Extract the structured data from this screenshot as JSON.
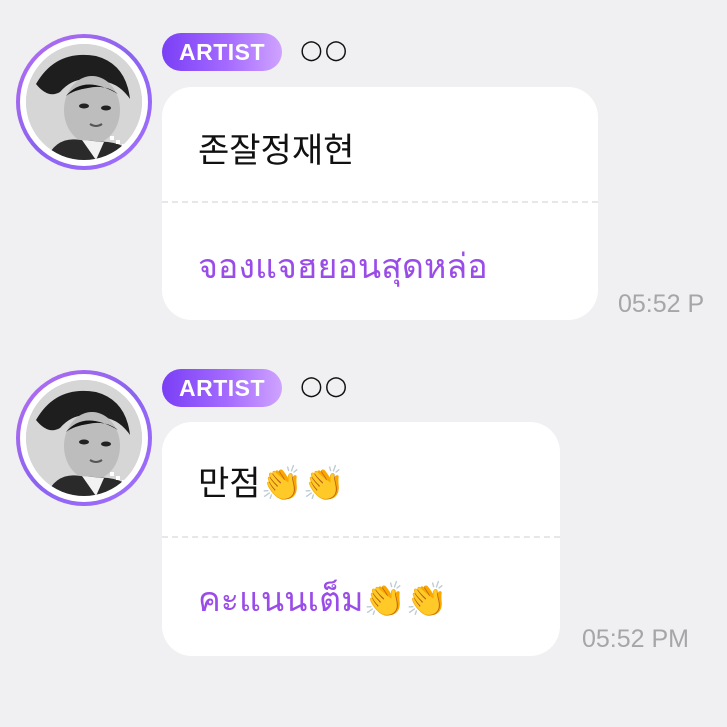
{
  "messages": [
    {
      "badge": "ARTIST",
      "sender": "○○",
      "text": "존잘정재현",
      "translation": "จองแจฮยอนสุดหล่อ",
      "time": "05:52 P"
    },
    {
      "badge": "ARTIST",
      "sender": "○○",
      "text": "만점👏👏",
      "translation": "คะแนนเต็ม👏👏",
      "time": "05:52 PM"
    }
  ],
  "colors": {
    "background": "#f0f0f2",
    "bubble": "#ffffff",
    "translation_text": "#9a4ce8",
    "badge_start": "#7a3ff5",
    "badge_end": "#cfa3ff",
    "time_text": "#a6a6aa"
  },
  "icons": {
    "avatar": "artist-profile-photo"
  }
}
